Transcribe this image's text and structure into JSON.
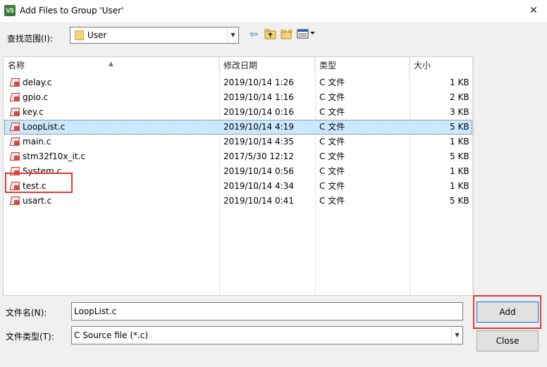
{
  "window": {
    "title": "Add Files to Group 'User'",
    "icon_text": "V5"
  },
  "lookin": {
    "label": "查找范围(I):",
    "value": "User"
  },
  "toolbar": [
    "back-arrow-icon",
    "up-folder-icon",
    "new-folder-icon",
    "view-menu-icon"
  ],
  "columns": {
    "name": "名称",
    "date": "修改日期",
    "type": "类型",
    "size": "大小"
  },
  "files": [
    {
      "name": "delay.c",
      "date": "2019/10/14 1:26",
      "type": "C 文件",
      "size": "1 KB"
    },
    {
      "name": "gpio.c",
      "date": "2019/10/14 1:16",
      "type": "C 文件",
      "size": "2 KB"
    },
    {
      "name": "key.c",
      "date": "2019/10/14 0:16",
      "type": "C 文件",
      "size": "3 KB"
    },
    {
      "name": "LoopList.c",
      "date": "2019/10/14 4:19",
      "type": "C 文件",
      "size": "5 KB"
    },
    {
      "name": "main.c",
      "date": "2019/10/14 4:35",
      "type": "C 文件",
      "size": "1 KB"
    },
    {
      "name": "stm32f10x_it.c",
      "date": "2017/5/30 12:12",
      "type": "C 文件",
      "size": "5 KB"
    },
    {
      "name": "System.c",
      "date": "2019/10/14 0:56",
      "type": "C 文件",
      "size": "1 KB"
    },
    {
      "name": "test.c",
      "date": "2019/10/14 4:34",
      "type": "C 文件",
      "size": "1 KB"
    },
    {
      "name": "usart.c",
      "date": "2019/10/14 0:41",
      "type": "C 文件",
      "size": "5 KB"
    }
  ],
  "selected_file": "LoopList.c",
  "filename": {
    "label": "文件名(N):",
    "value": "LoopList.c"
  },
  "filetype": {
    "label": "文件类型(T):",
    "value": "C Source file (*.c)"
  },
  "buttons": {
    "add": "Add",
    "close": "Close"
  },
  "colors": {
    "selection": "#cce8ff",
    "highlight": "#e53935"
  }
}
